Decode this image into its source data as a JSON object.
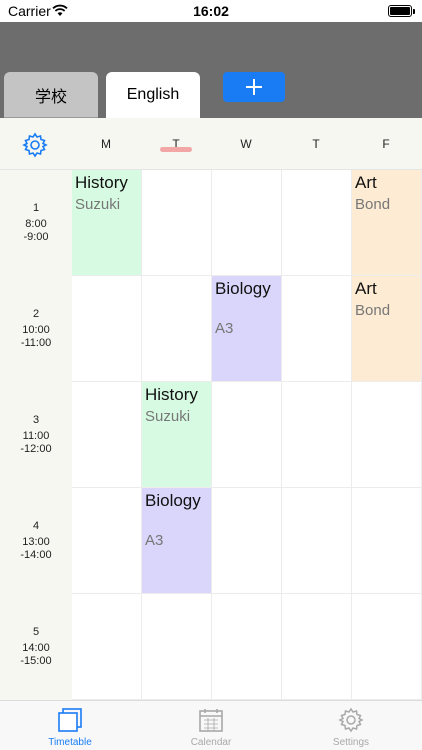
{
  "status": {
    "carrier": "Carrier",
    "time": "16:02"
  },
  "tabs": [
    {
      "label": "学校",
      "active": false
    },
    {
      "label": "English",
      "active": true
    }
  ],
  "add_button": {
    "icon": "plus-icon"
  },
  "days": [
    "M",
    "T",
    "W",
    "T",
    "F"
  ],
  "today_index": 1,
  "periods": [
    {
      "num": "1",
      "start": "8:00",
      "end": "-9:00"
    },
    {
      "num": "2",
      "start": "10:00",
      "end": "-11:00"
    },
    {
      "num": "3",
      "start": "11:00",
      "end": "-12:00"
    },
    {
      "num": "4",
      "start": "13:00",
      "end": "-14:00"
    },
    {
      "num": "5",
      "start": "14:00",
      "end": "-15:00"
    }
  ],
  "lessons": [
    {
      "subject": "History",
      "teacher": "Suzuki",
      "day": 0,
      "period": 0,
      "color": "#d7fbe2"
    },
    {
      "subject": "Art",
      "teacher": "Bond",
      "day": 4,
      "period": 0,
      "color": "#fdebd3"
    },
    {
      "subject": "Biology",
      "room": "A3",
      "day": 2,
      "period": 1,
      "color": "#d9d5fb"
    },
    {
      "subject": "Art",
      "teacher": "Bond",
      "day": 4,
      "period": 1,
      "color": "#fdebd3"
    },
    {
      "subject": "History",
      "teacher": "Suzuki",
      "day": 1,
      "period": 2,
      "color": "#d7fbe2"
    },
    {
      "subject": "Biology",
      "room": "A3",
      "day": 1,
      "period": 3,
      "color": "#d9d5fb"
    }
  ],
  "tab_bar": [
    {
      "label": "Timetable",
      "icon": "timetable-icon",
      "active": true
    },
    {
      "label": "Calendar",
      "icon": "calendar-icon",
      "active": false
    },
    {
      "label": "Settings",
      "icon": "settings-icon",
      "active": false
    }
  ],
  "colors": {
    "accent": "#1a7cf5",
    "header": "#6d6d6d",
    "today_marker": "#f2a6a6",
    "inactive_tab_text": "#a8a8a8"
  }
}
